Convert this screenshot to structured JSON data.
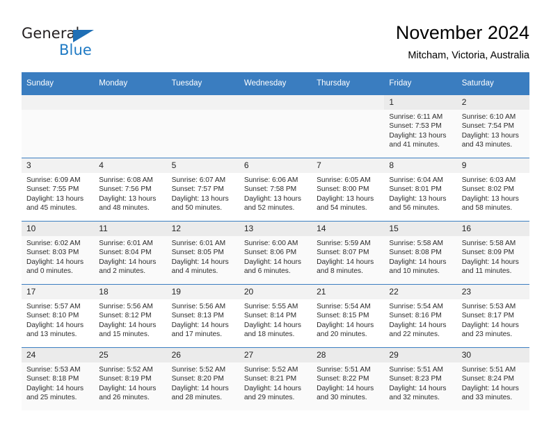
{
  "brand": {
    "name_top": "General",
    "name_bottom": "Blue",
    "triangle_color": "#1f6fb5",
    "blue_color": "#1f7ac4"
  },
  "header": {
    "title": "November 2024",
    "subtitle": "Mitcham, Victoria, Australia",
    "header_bg": "#3a7dc0"
  },
  "weekdays": [
    "Sunday",
    "Monday",
    "Tuesday",
    "Wednesday",
    "Thursday",
    "Friday",
    "Saturday"
  ],
  "labels": {
    "sunrise": "Sunrise:",
    "sunset": "Sunset:",
    "daylight": "Daylight:"
  },
  "weeks": [
    {
      "days": [
        {
          "empty": true
        },
        {
          "empty": true
        },
        {
          "empty": true
        },
        {
          "empty": true
        },
        {
          "empty": true
        },
        {
          "date": "1",
          "sunrise": "Sunrise: 6:11 AM",
          "sunset": "Sunset: 7:53 PM",
          "daylight_1": "Daylight: 13 hours",
          "daylight_2": "and 41 minutes."
        },
        {
          "date": "2",
          "sunrise": "Sunrise: 6:10 AM",
          "sunset": "Sunset: 7:54 PM",
          "daylight_1": "Daylight: 13 hours",
          "daylight_2": "and 43 minutes."
        }
      ]
    },
    {
      "days": [
        {
          "date": "3",
          "sunrise": "Sunrise: 6:09 AM",
          "sunset": "Sunset: 7:55 PM",
          "daylight_1": "Daylight: 13 hours",
          "daylight_2": "and 45 minutes."
        },
        {
          "date": "4",
          "sunrise": "Sunrise: 6:08 AM",
          "sunset": "Sunset: 7:56 PM",
          "daylight_1": "Daylight: 13 hours",
          "daylight_2": "and 48 minutes."
        },
        {
          "date": "5",
          "sunrise": "Sunrise: 6:07 AM",
          "sunset": "Sunset: 7:57 PM",
          "daylight_1": "Daylight: 13 hours",
          "daylight_2": "and 50 minutes."
        },
        {
          "date": "6",
          "sunrise": "Sunrise: 6:06 AM",
          "sunset": "Sunset: 7:58 PM",
          "daylight_1": "Daylight: 13 hours",
          "daylight_2": "and 52 minutes."
        },
        {
          "date": "7",
          "sunrise": "Sunrise: 6:05 AM",
          "sunset": "Sunset: 8:00 PM",
          "daylight_1": "Daylight: 13 hours",
          "daylight_2": "and 54 minutes."
        },
        {
          "date": "8",
          "sunrise": "Sunrise: 6:04 AM",
          "sunset": "Sunset: 8:01 PM",
          "daylight_1": "Daylight: 13 hours",
          "daylight_2": "and 56 minutes."
        },
        {
          "date": "9",
          "sunrise": "Sunrise: 6:03 AM",
          "sunset": "Sunset: 8:02 PM",
          "daylight_1": "Daylight: 13 hours",
          "daylight_2": "and 58 minutes."
        }
      ]
    },
    {
      "days": [
        {
          "date": "10",
          "sunrise": "Sunrise: 6:02 AM",
          "sunset": "Sunset: 8:03 PM",
          "daylight_1": "Daylight: 14 hours",
          "daylight_2": "and 0 minutes."
        },
        {
          "date": "11",
          "sunrise": "Sunrise: 6:01 AM",
          "sunset": "Sunset: 8:04 PM",
          "daylight_1": "Daylight: 14 hours",
          "daylight_2": "and 2 minutes."
        },
        {
          "date": "12",
          "sunrise": "Sunrise: 6:01 AM",
          "sunset": "Sunset: 8:05 PM",
          "daylight_1": "Daylight: 14 hours",
          "daylight_2": "and 4 minutes."
        },
        {
          "date": "13",
          "sunrise": "Sunrise: 6:00 AM",
          "sunset": "Sunset: 8:06 PM",
          "daylight_1": "Daylight: 14 hours",
          "daylight_2": "and 6 minutes."
        },
        {
          "date": "14",
          "sunrise": "Sunrise: 5:59 AM",
          "sunset": "Sunset: 8:07 PM",
          "daylight_1": "Daylight: 14 hours",
          "daylight_2": "and 8 minutes."
        },
        {
          "date": "15",
          "sunrise": "Sunrise: 5:58 AM",
          "sunset": "Sunset: 8:08 PM",
          "daylight_1": "Daylight: 14 hours",
          "daylight_2": "and 10 minutes."
        },
        {
          "date": "16",
          "sunrise": "Sunrise: 5:58 AM",
          "sunset": "Sunset: 8:09 PM",
          "daylight_1": "Daylight: 14 hours",
          "daylight_2": "and 11 minutes."
        }
      ]
    },
    {
      "days": [
        {
          "date": "17",
          "sunrise": "Sunrise: 5:57 AM",
          "sunset": "Sunset: 8:10 PM",
          "daylight_1": "Daylight: 14 hours",
          "daylight_2": "and 13 minutes."
        },
        {
          "date": "18",
          "sunrise": "Sunrise: 5:56 AM",
          "sunset": "Sunset: 8:12 PM",
          "daylight_1": "Daylight: 14 hours",
          "daylight_2": "and 15 minutes."
        },
        {
          "date": "19",
          "sunrise": "Sunrise: 5:56 AM",
          "sunset": "Sunset: 8:13 PM",
          "daylight_1": "Daylight: 14 hours",
          "daylight_2": "and 17 minutes."
        },
        {
          "date": "20",
          "sunrise": "Sunrise: 5:55 AM",
          "sunset": "Sunset: 8:14 PM",
          "daylight_1": "Daylight: 14 hours",
          "daylight_2": "and 18 minutes."
        },
        {
          "date": "21",
          "sunrise": "Sunrise: 5:54 AM",
          "sunset": "Sunset: 8:15 PM",
          "daylight_1": "Daylight: 14 hours",
          "daylight_2": "and 20 minutes."
        },
        {
          "date": "22",
          "sunrise": "Sunrise: 5:54 AM",
          "sunset": "Sunset: 8:16 PM",
          "daylight_1": "Daylight: 14 hours",
          "daylight_2": "and 22 minutes."
        },
        {
          "date": "23",
          "sunrise": "Sunrise: 5:53 AM",
          "sunset": "Sunset: 8:17 PM",
          "daylight_1": "Daylight: 14 hours",
          "daylight_2": "and 23 minutes."
        }
      ]
    },
    {
      "days": [
        {
          "date": "24",
          "sunrise": "Sunrise: 5:53 AM",
          "sunset": "Sunset: 8:18 PM",
          "daylight_1": "Daylight: 14 hours",
          "daylight_2": "and 25 minutes."
        },
        {
          "date": "25",
          "sunrise": "Sunrise: 5:52 AM",
          "sunset": "Sunset: 8:19 PM",
          "daylight_1": "Daylight: 14 hours",
          "daylight_2": "and 26 minutes."
        },
        {
          "date": "26",
          "sunrise": "Sunrise: 5:52 AM",
          "sunset": "Sunset: 8:20 PM",
          "daylight_1": "Daylight: 14 hours",
          "daylight_2": "and 28 minutes."
        },
        {
          "date": "27",
          "sunrise": "Sunrise: 5:52 AM",
          "sunset": "Sunset: 8:21 PM",
          "daylight_1": "Daylight: 14 hours",
          "daylight_2": "and 29 minutes."
        },
        {
          "date": "28",
          "sunrise": "Sunrise: 5:51 AM",
          "sunset": "Sunset: 8:22 PM",
          "daylight_1": "Daylight: 14 hours",
          "daylight_2": "and 30 minutes."
        },
        {
          "date": "29",
          "sunrise": "Sunrise: 5:51 AM",
          "sunset": "Sunset: 8:23 PM",
          "daylight_1": "Daylight: 14 hours",
          "daylight_2": "and 32 minutes."
        },
        {
          "date": "30",
          "sunrise": "Sunrise: 5:51 AM",
          "sunset": "Sunset: 8:24 PM",
          "daylight_1": "Daylight: 14 hours",
          "daylight_2": "and 33 minutes."
        }
      ]
    }
  ]
}
